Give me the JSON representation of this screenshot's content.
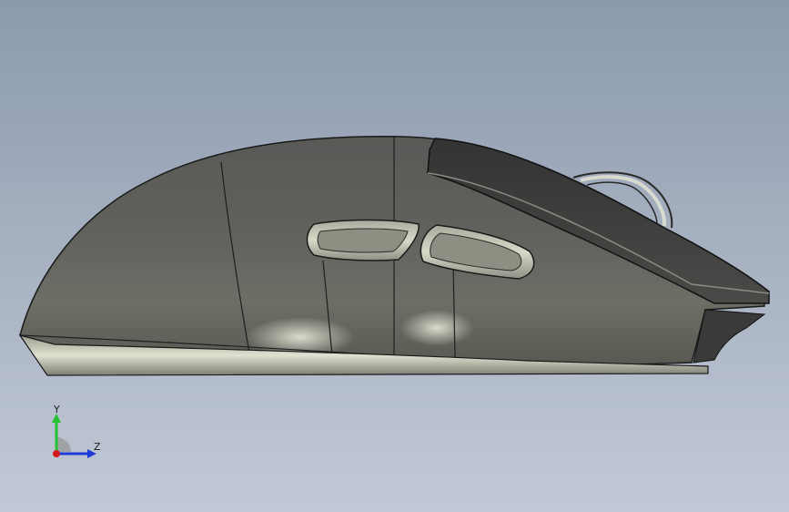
{
  "viewport": {
    "background_top": "#8c9aae",
    "background_bottom": "#c2c9d6"
  },
  "model": {
    "body_color": "#4a4a48",
    "highlight_color": "#dfe3d2",
    "edge_color": "#1a1a1a"
  },
  "triad": {
    "y_label": "Y",
    "z_label": "Z",
    "y_axis_color": "#22c233",
    "z_axis_color": "#1f3cd6",
    "origin_color": "#d21a1a"
  }
}
